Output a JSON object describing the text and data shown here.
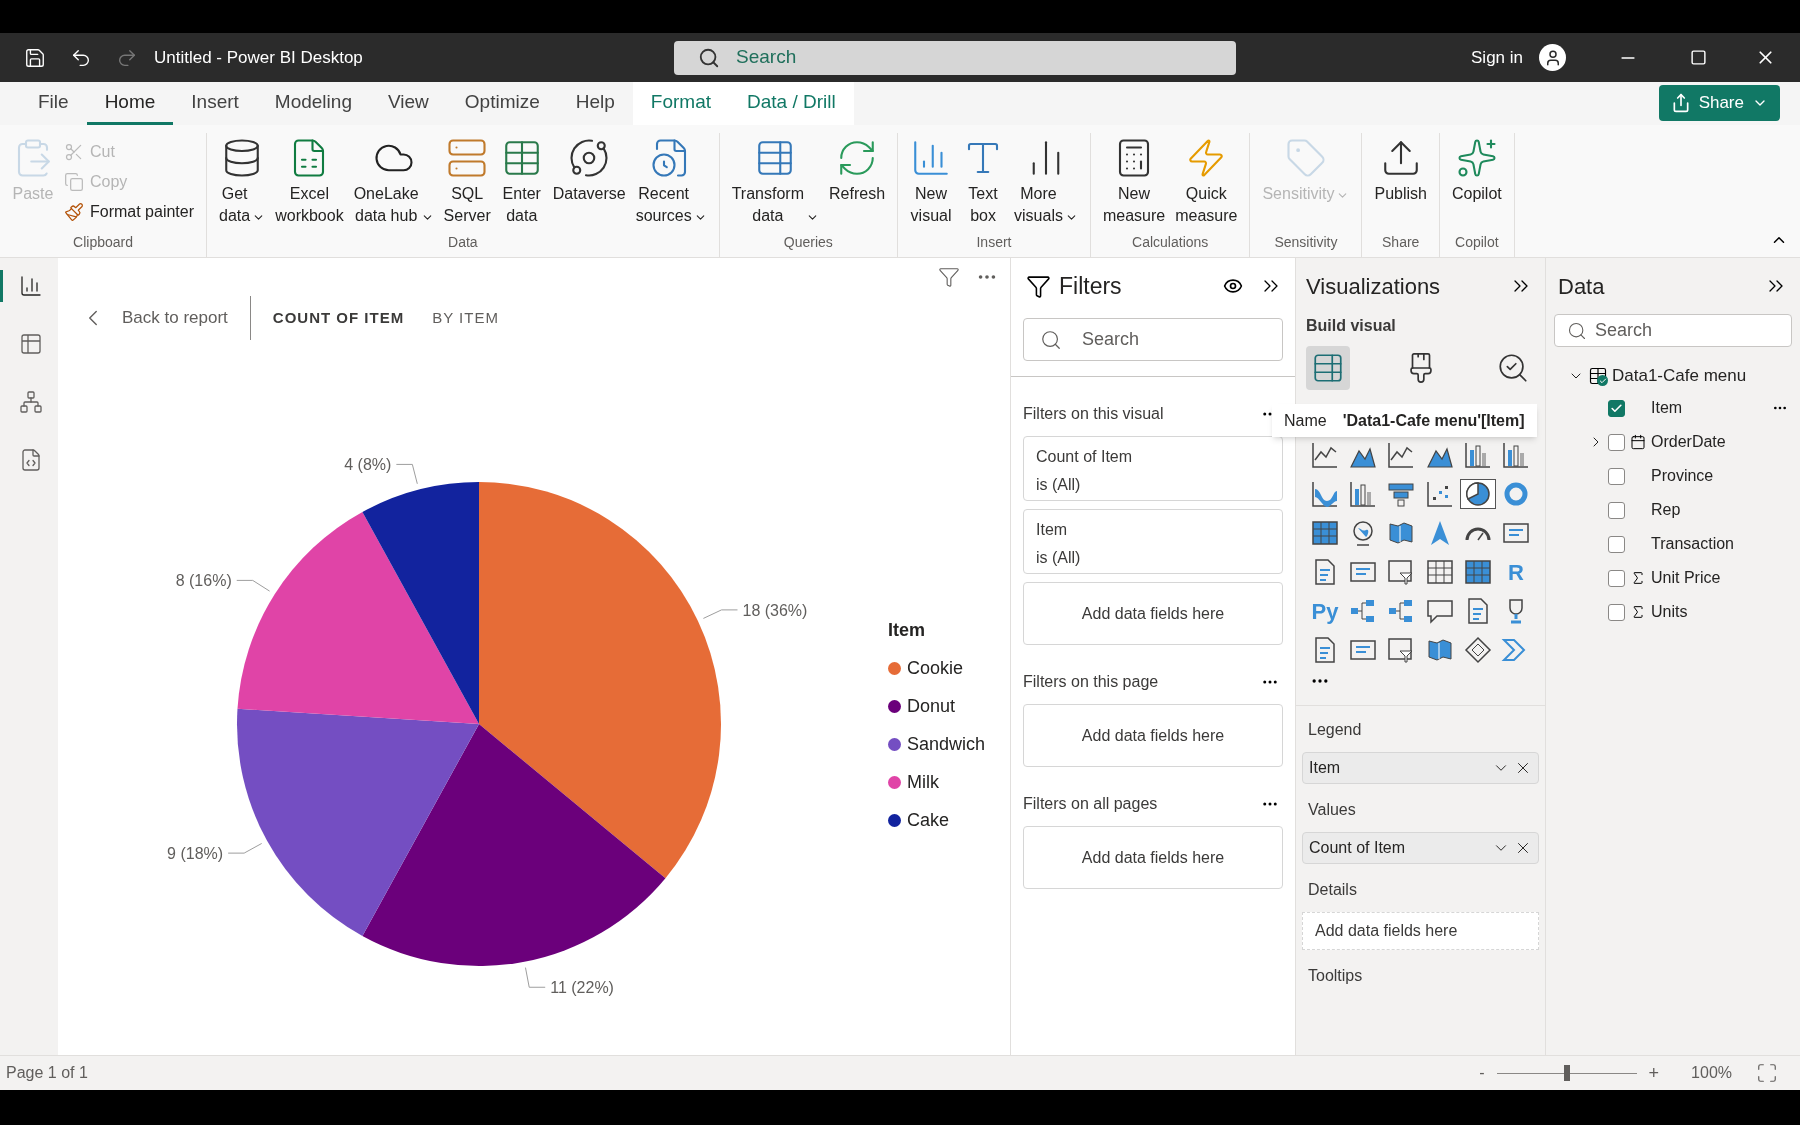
{
  "window": {
    "title": "Untitled - Power BI Desktop",
    "search_placeholder": "Search",
    "sign_in": "Sign in"
  },
  "tabs": [
    {
      "label": "File",
      "selected": false,
      "kind": "normal"
    },
    {
      "label": "Home",
      "selected": true,
      "kind": "normal"
    },
    {
      "label": "Insert",
      "selected": false,
      "kind": "normal"
    },
    {
      "label": "Modeling",
      "selected": false,
      "kind": "normal"
    },
    {
      "label": "View",
      "selected": false,
      "kind": "normal"
    },
    {
      "label": "Optimize",
      "selected": false,
      "kind": "normal"
    },
    {
      "label": "Help",
      "selected": false,
      "kind": "normal"
    },
    {
      "label": "Format",
      "selected": false,
      "kind": "contextual"
    },
    {
      "label": "Data / Drill",
      "selected": false,
      "kind": "contextual"
    }
  ],
  "share_button": "Share",
  "ribbon": [
    {
      "label": "Clipboard",
      "items": [
        {
          "kind": "large",
          "lines": [
            "Paste"
          ],
          "disabled": true,
          "dropdown": false
        },
        {
          "kind": "small",
          "lines": [
            "Cut"
          ],
          "disabled": true,
          "dropdown": false
        },
        {
          "kind": "small",
          "lines": [
            "Copy"
          ],
          "disabled": true,
          "dropdown": false
        },
        {
          "kind": "small",
          "lines": [
            "Format painter"
          ],
          "disabled": false,
          "dropdown": false
        }
      ]
    },
    {
      "label": "Data",
      "items": [
        {
          "kind": "large",
          "lines": [
            "Get",
            "data"
          ],
          "disabled": false,
          "dropdown": true
        },
        {
          "kind": "large",
          "lines": [
            "Excel",
            "workbook"
          ],
          "disabled": false,
          "dropdown": false
        },
        {
          "kind": "large",
          "lines": [
            "OneLake",
            "data hub"
          ],
          "disabled": false,
          "dropdown": true
        },
        {
          "kind": "large",
          "lines": [
            "SQL",
            "Server"
          ],
          "disabled": false,
          "dropdown": false
        },
        {
          "kind": "large",
          "lines": [
            "Enter",
            "data"
          ],
          "disabled": false,
          "dropdown": false
        },
        {
          "kind": "large",
          "lines": [
            "Dataverse"
          ],
          "disabled": false,
          "dropdown": false
        },
        {
          "kind": "large",
          "lines": [
            "Recent",
            "sources"
          ],
          "disabled": false,
          "dropdown": true
        }
      ]
    },
    {
      "label": "Queries",
      "items": [
        {
          "kind": "large",
          "lines": [
            "Transform",
            "data"
          ],
          "disabled": false,
          "dropdown": true
        },
        {
          "kind": "large",
          "lines": [
            "Refresh"
          ],
          "disabled": false,
          "dropdown": false
        }
      ]
    },
    {
      "label": "Insert",
      "items": [
        {
          "kind": "large",
          "lines": [
            "New",
            "visual"
          ],
          "disabled": false,
          "dropdown": false
        },
        {
          "kind": "large",
          "lines": [
            "Text",
            "box"
          ],
          "disabled": false,
          "dropdown": false
        },
        {
          "kind": "large",
          "lines": [
            "More",
            "visuals"
          ],
          "disabled": false,
          "dropdown": true
        }
      ]
    },
    {
      "label": "Calculations",
      "items": [
        {
          "kind": "large",
          "lines": [
            "New",
            "measure"
          ],
          "disabled": false,
          "dropdown": false
        },
        {
          "kind": "large",
          "lines": [
            "Quick",
            "measure"
          ],
          "disabled": false,
          "dropdown": false
        }
      ]
    },
    {
      "label": "Sensitivity",
      "items": [
        {
          "kind": "large",
          "lines": [
            "Sensitivity"
          ],
          "disabled": true,
          "dropdown": true
        }
      ]
    },
    {
      "label": "Share",
      "items": [
        {
          "kind": "large",
          "lines": [
            "Publish"
          ],
          "disabled": false,
          "dropdown": false
        }
      ]
    },
    {
      "label": "Copilot",
      "items": [
        {
          "kind": "large",
          "lines": [
            "Copilot"
          ],
          "disabled": false,
          "dropdown": false
        }
      ]
    }
  ],
  "views": [
    {
      "selected": true
    },
    {
      "selected": false
    },
    {
      "selected": false
    },
    {
      "selected": false
    }
  ],
  "canvas": {
    "back": "Back to report",
    "headings": [
      {
        "label": "COUNT OF ITEM",
        "selected": true
      },
      {
        "label": "BY ITEM",
        "selected": false
      }
    ],
    "chart_data": {
      "type": "pie",
      "legend": {
        "title": "Item"
      },
      "categories": [
        "Cookie",
        "Donut",
        "Sandwich",
        "Milk",
        "Cake"
      ],
      "values": [
        36,
        22,
        18,
        16,
        8
      ],
      "colors": [
        "#e66c37",
        "#6b007b",
        "#744ec2",
        "#e044a7",
        "#12239e"
      ],
      "value_labels": [
        "18 (36%)",
        "11 (22%)",
        "9 (18%)",
        "8 (16%)",
        "4 (8%)"
      ]
    }
  },
  "filters": {
    "title": "Filters",
    "search_placeholder": "Search",
    "sections": [
      {
        "title": "Filters on this visual",
        "cards": [
          {
            "field": "Count of Item",
            "condition": "is (All)"
          },
          {
            "field": "Item",
            "condition": "is (All)"
          }
        ],
        "add": "Add data fields here"
      },
      {
        "title": "Filters on this page",
        "add": "Add data fields here"
      },
      {
        "title": "Filters on all pages",
        "add": "Add data fields here"
      }
    ]
  },
  "visualizations": {
    "title": "Visualizations",
    "subtitle": "Build visual",
    "build_tabs": [
      {
        "selected": true
      },
      {
        "selected": false
      },
      {
        "selected": false
      }
    ],
    "visual_types": [
      {
        "selected": false
      },
      {
        "selected": false
      },
      {
        "selected": false
      },
      {
        "selected": false
      },
      {
        "selected": false
      },
      {
        "selected": false
      },
      {
        "selected": false
      },
      {
        "selected": false
      },
      {
        "selected": false
      },
      {
        "selected": false
      },
      {
        "selected": true
      },
      {
        "selected": false
      },
      {
        "selected": false
      },
      {
        "selected": false
      },
      {
        "selected": false
      },
      {
        "selected": false
      },
      {
        "selected": false
      },
      {
        "selected": false
      },
      {
        "selected": false
      },
      {
        "selected": false
      },
      {
        "selected": false
      },
      {
        "selected": false
      },
      {
        "selected": false
      },
      {
        "selected": false
      },
      {
        "selected": false
      },
      {
        "selected": false
      },
      {
        "selected": false
      },
      {
        "selected": false
      },
      {
        "selected": false
      },
      {
        "selected": false
      },
      {
        "selected": false
      },
      {
        "selected": false
      },
      {
        "selected": false
      },
      {
        "selected": false
      },
      {
        "selected": false
      },
      {
        "selected": false
      }
    ],
    "r_label": "R",
    "py_label": "Py",
    "wells": [
      {
        "title": "Legend",
        "field": "Item"
      },
      {
        "title": "Values",
        "field": "Count of Item"
      },
      {
        "title": "Details",
        "placeholder": "Add data fields here"
      },
      {
        "title": "Tooltips"
      }
    ]
  },
  "tooltip": {
    "key": "Name",
    "value": "'Data1-Cafe menu'[Item]"
  },
  "data_pane": {
    "title": "Data",
    "search_placeholder": "Search",
    "tables": [
      {
        "name": "Data1-Cafe menu",
        "expanded": true,
        "children": [
          {
            "name": "Item",
            "checked": true,
            "kind": "text"
          },
          {
            "name": "OrderDate",
            "checked": false,
            "kind": "date",
            "expanded": false
          },
          {
            "name": "Province",
            "checked": false,
            "kind": "text"
          },
          {
            "name": "Rep",
            "checked": false,
            "kind": "text"
          },
          {
            "name": "Transaction",
            "checked": false,
            "kind": "text"
          },
          {
            "name": "Unit Price",
            "checked": false,
            "kind": "sum"
          },
          {
            "name": "Units",
            "checked": false,
            "kind": "sum"
          }
        ]
      }
    ]
  },
  "status_bar": {
    "page": "Page 1 of 1",
    "zoom_out": "-",
    "zoom_in": "+",
    "zoom": "100%",
    "level": 0.5
  }
}
